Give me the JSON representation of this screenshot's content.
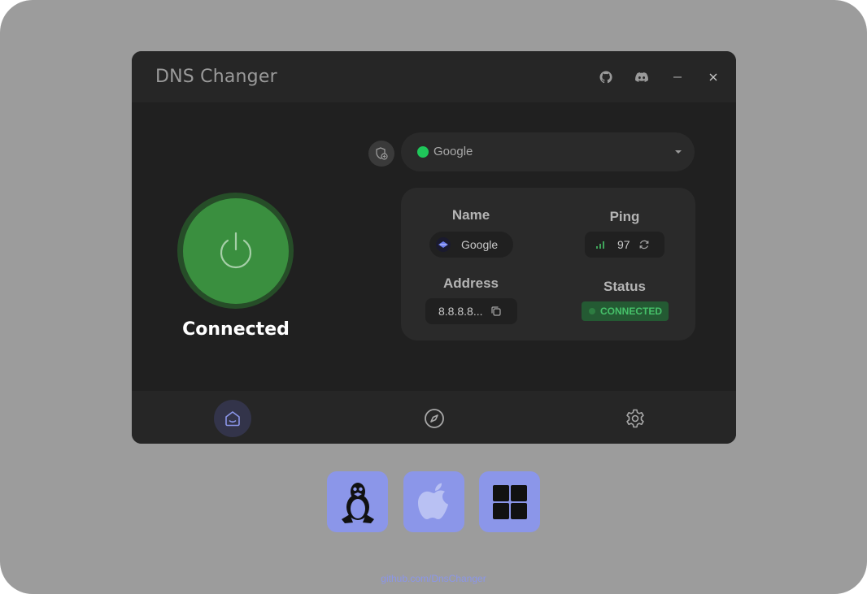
{
  "app": {
    "title": "DNS Changer"
  },
  "titlebar": {
    "icons": [
      "github-icon",
      "discord-icon",
      "minimize-icon",
      "close-icon"
    ]
  },
  "power": {
    "state_label": "Connected"
  },
  "server_select": {
    "selected": "Google",
    "status_color": "#1fc75a"
  },
  "info": {
    "name_label": "Name",
    "name_value": "Google",
    "ping_label": "Ping",
    "ping_value": "97",
    "address_label": "Address",
    "address_value": "8.8.8.8...",
    "status_label": "Status",
    "status_value": "CONNECTED"
  },
  "nav": {
    "items": [
      {
        "name": "home",
        "icon": "home-icon",
        "active": true
      },
      {
        "name": "explore",
        "icon": "compass-icon",
        "active": false
      },
      {
        "name": "settings",
        "icon": "gear-icon",
        "active": false
      }
    ]
  },
  "platforms": [
    "linux-icon",
    "apple-icon",
    "windows-icon"
  ],
  "footer": {
    "link": "github.com/DnsChanger"
  },
  "colors": {
    "background": "#9c9c9c",
    "window": "#202020",
    "accent": "#8b96e9",
    "connected_green": "#3a8f3f",
    "status_green": "#46c16a"
  }
}
